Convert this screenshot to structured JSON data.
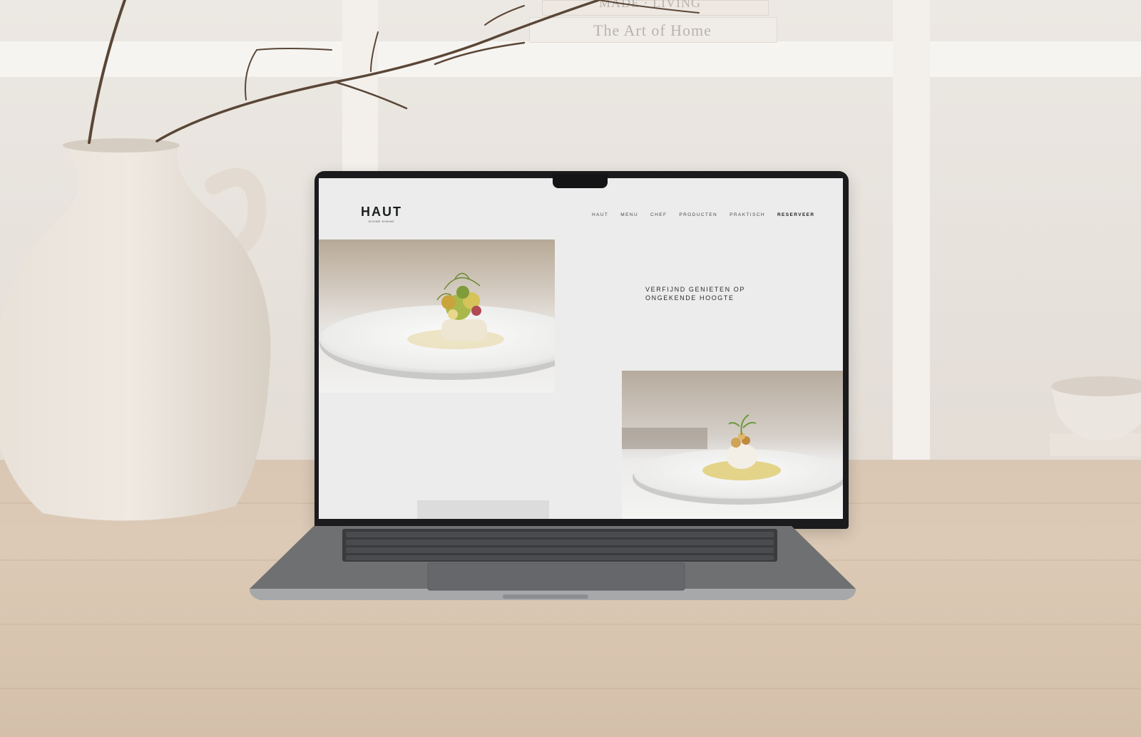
{
  "scene": {
    "book_title": "The Art of Home",
    "book_title_top": "MADE · LIVING"
  },
  "site": {
    "brand": {
      "name": "HAUT",
      "tagline": "DIVINE DINING"
    },
    "nav": {
      "items": [
        {
          "label": "HAUT"
        },
        {
          "label": "MENU"
        },
        {
          "label": "CHEF"
        },
        {
          "label": "PRODUCTEN"
        },
        {
          "label": "PRAKTISCH"
        }
      ],
      "cta_label": "RESERVEER"
    },
    "hero": {
      "line1": "VERFIJND GENIETEN OP",
      "line2": "ONGEKENDE HOOGTE"
    },
    "colors": {
      "background": "#ececec",
      "text": "#1c1f1e"
    }
  }
}
